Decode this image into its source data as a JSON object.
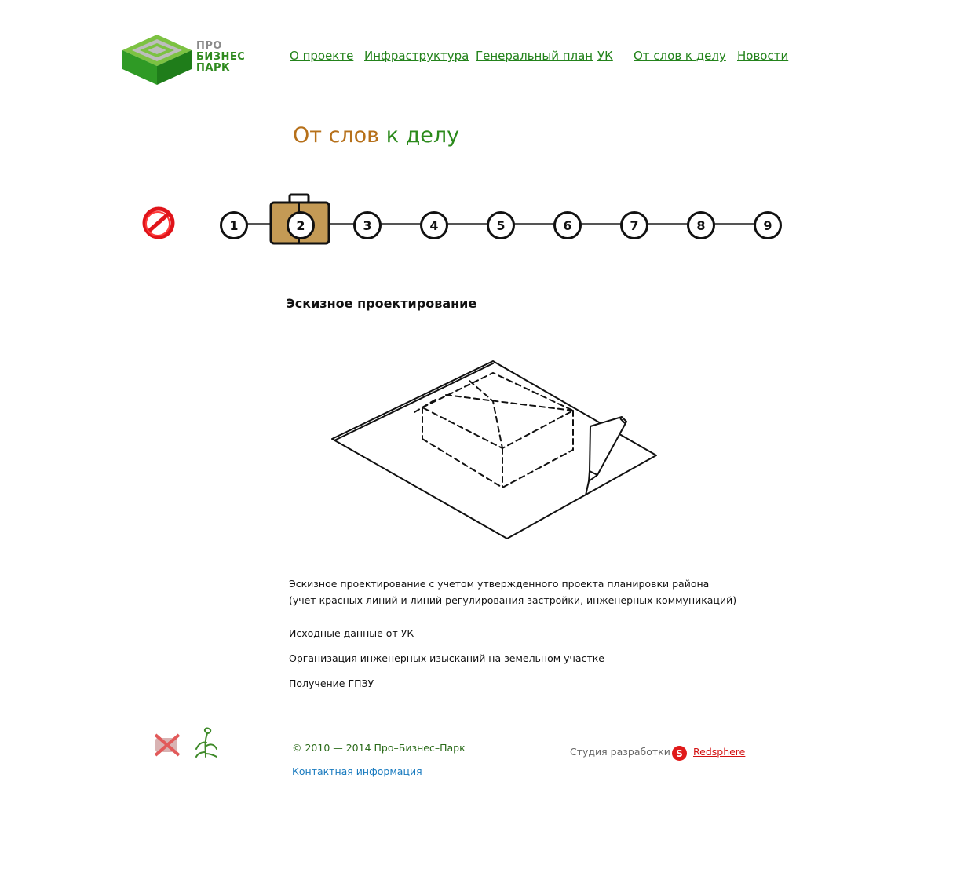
{
  "header": {
    "logo": {
      "line1": "ПРО",
      "line2": "БИЗНЕС",
      "line3": "ПАРК"
    },
    "nav": [
      {
        "label": "О проекте"
      },
      {
        "label": "Инфраструктура"
      },
      {
        "label": "Генеральный план"
      },
      {
        "label": "УК"
      },
      {
        "label": "От слов к делу"
      },
      {
        "label": "Новости"
      }
    ]
  },
  "page": {
    "title_part1": "От слов",
    "title_part2": "к делу",
    "colors": {
      "title_part1": "#b6701a",
      "title_part2": "#2b8a1b",
      "link": "#23831b"
    }
  },
  "steps": {
    "items": [
      "1",
      "2",
      "3",
      "4",
      "5",
      "6",
      "7",
      "8",
      "9"
    ],
    "active_index": 1,
    "start_icon": "crossed-out-circle-icon",
    "active_icon": "briefcase-icon"
  },
  "content": {
    "heading": "Эскизное проектирование",
    "illustration": "sketch-box-on-paper-with-pencil",
    "paragraphs": [
      "Эскизное проектирование с учетом утвержденного проекта планировки района",
      "(учет красных линий и линий регулирования застройки, инженерных коммуникаций)",
      "Исходные данные от УК",
      "Организация инженерных изысканий на земельном участке",
      "Получение ГПЗУ"
    ]
  },
  "footer": {
    "copyright": "© 2010 — 2014 Про–Бизнес–Парк",
    "contact": "Контактная информация",
    "studio_label": "Студия разработки",
    "studio_logo_letter": "S",
    "studio_name": "Redsphere",
    "icons": [
      "no-smoking-icon",
      "plant-icon"
    ]
  }
}
